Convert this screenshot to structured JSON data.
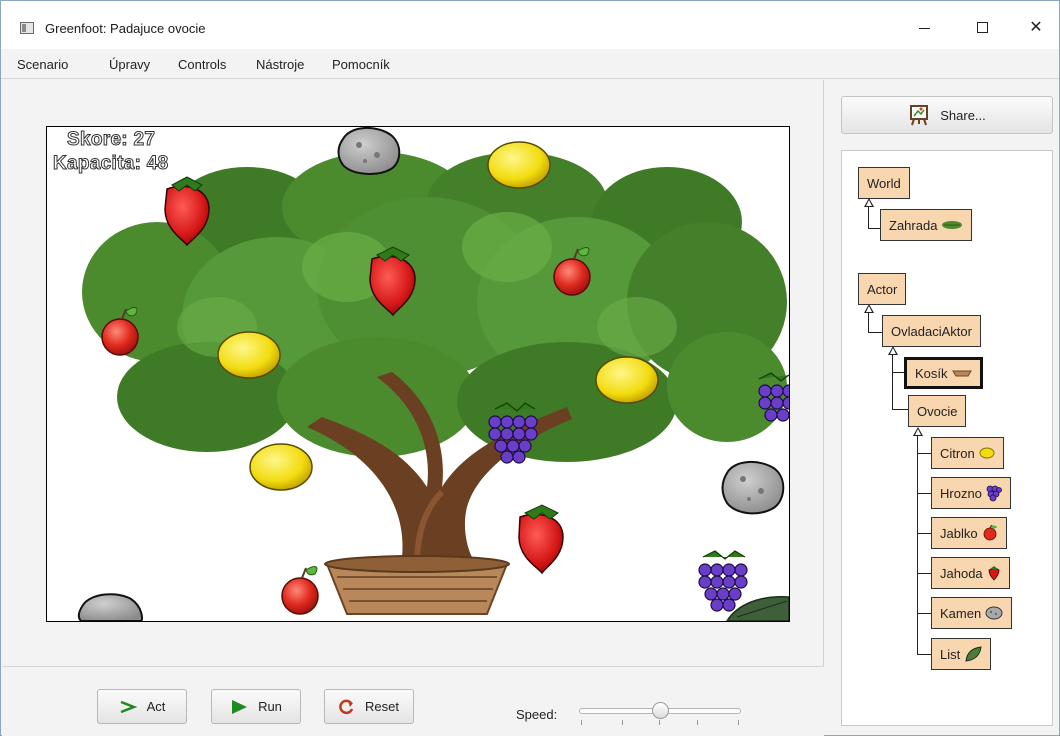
{
  "window": {
    "title": "Greenfoot: Padajuce ovocie",
    "controls": {
      "minimize": "—",
      "maximize": "☐",
      "close": "✕"
    }
  },
  "menu": {
    "items": [
      "Scenario",
      "Úpravy",
      "Controls",
      "Nástroje",
      "Pomocník"
    ]
  },
  "world": {
    "hud": {
      "score": "Skore: 27",
      "capacity": "Kapacita: 48"
    },
    "sprites": [
      "tree",
      "basket",
      "lemon",
      "lemon",
      "lemon",
      "lemon",
      "strawberry",
      "strawberry",
      "strawberry",
      "apple",
      "apple",
      "apple",
      "grapes",
      "grapes",
      "grapes",
      "rock",
      "rock",
      "rock",
      "leaf"
    ]
  },
  "controls": {
    "act_label": "Act",
    "run_label": "Run",
    "reset_label": "Reset",
    "speed_label": "Speed:",
    "speed_value": 0.5
  },
  "sidebar": {
    "share_label": "Share...",
    "classes": {
      "world": "World",
      "zahrada": "Zahrada",
      "actor": "Actor",
      "ovladaci": "OvladaciAktor",
      "kosik": "Kosík",
      "ovocie": "Ovocie",
      "citron": "Citron",
      "hrozno": "Hrozno",
      "jablko": "Jablko",
      "jahoda": "Jahoda",
      "kamen": "Kamen",
      "list": "List"
    }
  },
  "colors": {
    "class_fill": "#f8d6af",
    "tree_green": "#4e8a2f",
    "trunk_brown": "#6b3f22"
  }
}
